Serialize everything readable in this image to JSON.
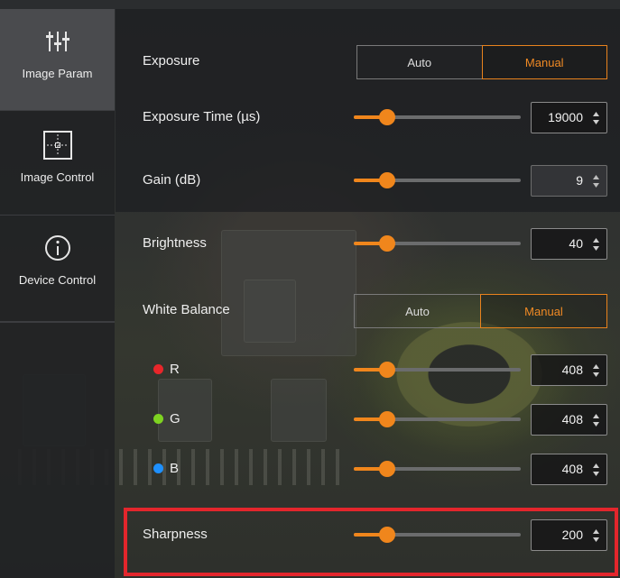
{
  "sidebar": {
    "tabs": [
      {
        "label": "Image Param",
        "icon": "sliders-icon",
        "active": true
      },
      {
        "label": "Image Control",
        "icon": "crosshair-frame-icon",
        "active": false
      },
      {
        "label": "Device Control",
        "icon": "info-circle-icon",
        "active": false
      }
    ]
  },
  "exposure": {
    "label": "Exposure",
    "options": [
      "Auto",
      "Manual"
    ],
    "selected": "Manual"
  },
  "exposure_time": {
    "label": "Exposure Time (µs)",
    "value": "19000",
    "slider_fraction": 0.2
  },
  "gain": {
    "label": "Gain (dB)",
    "value": "9",
    "slider_fraction": 0.2,
    "disabled": true
  },
  "brightness": {
    "label": "Brightness",
    "value": "40",
    "slider_fraction": 0.2
  },
  "white_balance": {
    "label": "White Balance",
    "options": [
      "Auto",
      "Manual"
    ],
    "selected": "Manual"
  },
  "channels": [
    {
      "label": "R",
      "value": "408",
      "slider_fraction": 0.2,
      "color": "#e8262a"
    },
    {
      "label": "G",
      "value": "408",
      "slider_fraction": 0.2,
      "color": "#7ed321"
    },
    {
      "label": "B",
      "value": "408",
      "slider_fraction": 0.2,
      "color": "#1e90ff"
    }
  ],
  "sharpness": {
    "label": "Sharpness",
    "value": "200",
    "slider_fraction": 0.2,
    "highlighted": true
  },
  "colors": {
    "accent": "#f0861c",
    "highlight_border": "#e3262c"
  }
}
